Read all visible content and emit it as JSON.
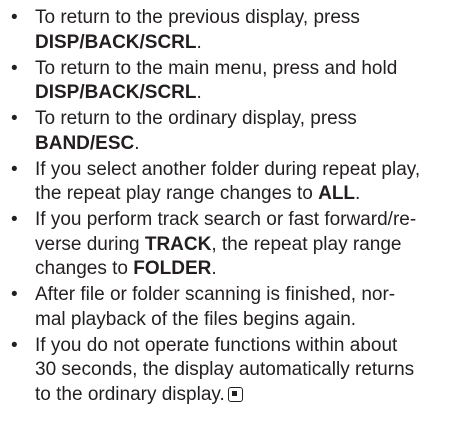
{
  "bullet_glyph": "•",
  "items": [
    {
      "l1": "To return to the previous display, press",
      "l2_bold": "DISP/BACK/SCRL",
      "l2_after": "."
    },
    {
      "l1": "To return to the main menu, press and hold",
      "l2_bold": "DISP/BACK/SCRL",
      "l2_after": "."
    },
    {
      "l1": "To return to the ordinary display, press",
      "l2_bold": "BAND/ESC",
      "l2_after": "."
    },
    {
      "l1": "If you select another folder during repeat play,",
      "l2_before": "the repeat play range changes to ",
      "l2_bold": "ALL",
      "l2_after": "."
    },
    {
      "l1": "If you perform track search or fast forward/re-",
      "l2_before": "verse during ",
      "l2_bold": "TRACK",
      "l2_after": ", the repeat play range",
      "l3_before": "changes to ",
      "l3_bold": "FOLDER",
      "l3_after": "."
    },
    {
      "l1": "After file or folder scanning is finished, nor-",
      "l2": "mal playback of the files begins again."
    },
    {
      "l1": "If you do not operate functions within about",
      "l2": "30 seconds, the display automatically returns",
      "l3": "to the ordinary display.",
      "end_icon": "end-of-section-icon"
    }
  ]
}
